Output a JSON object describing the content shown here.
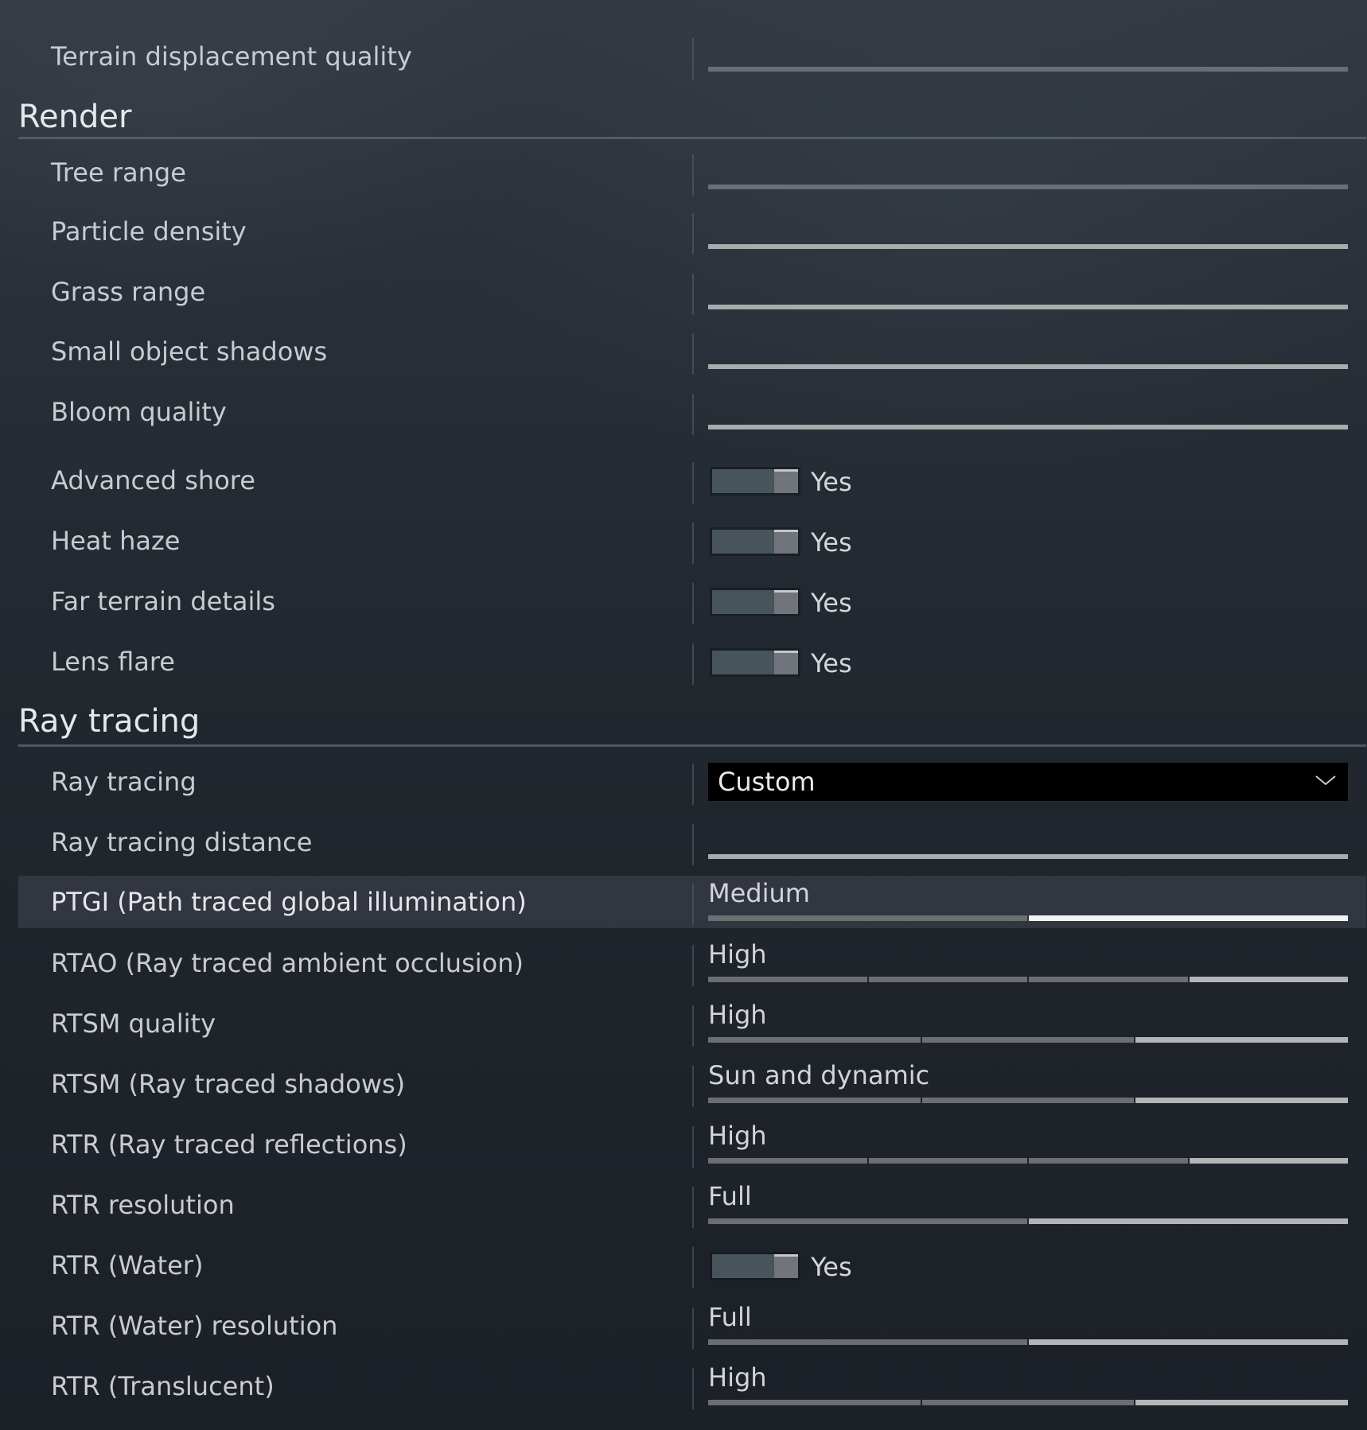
{
  "top_row": {
    "label": "Terrain displacement quality"
  },
  "render": {
    "title": "Render",
    "sliders": [
      {
        "label": "Tree range",
        "tone": "dark"
      },
      {
        "label": "Particle density",
        "tone": "light"
      },
      {
        "label": "Grass range",
        "tone": "light"
      },
      {
        "label": "Small object shadows",
        "tone": "light"
      },
      {
        "label": "Bloom quality",
        "tone": "light"
      }
    ],
    "toggles": [
      {
        "label": "Advanced shore",
        "value": "Yes"
      },
      {
        "label": "Heat haze",
        "value": "Yes"
      },
      {
        "label": "Far terrain details",
        "value": "Yes"
      },
      {
        "label": "Lens flare",
        "value": "Yes"
      }
    ]
  },
  "ray_tracing": {
    "title": "Ray tracing",
    "mode": {
      "label": "Ray tracing",
      "value": "Custom",
      "icon": "chevron-down-icon"
    },
    "distance": {
      "label": "Ray tracing distance"
    },
    "ptgi": {
      "label": "PTGI (Path traced global illumination)",
      "value": "Medium",
      "level": 1,
      "steps": 2
    },
    "rtao": {
      "label": "RTAO (Ray traced ambient occlusion)",
      "value": "High",
      "level": 3,
      "steps": 4
    },
    "rtsm_quality": {
      "label": "RTSM quality",
      "value": "High",
      "level": 2,
      "steps": 3
    },
    "rtsm": {
      "label": "RTSM (Ray traced shadows)",
      "value": "Sun and dynamic",
      "level": 2,
      "steps": 3
    },
    "rtr": {
      "label": "RTR (Ray traced reflections)",
      "value": "High",
      "level": 3,
      "steps": 4
    },
    "rtr_resolution": {
      "label": "RTR resolution",
      "value": "Full",
      "level": 1,
      "steps": 2
    },
    "rtr_water": {
      "label": "RTR (Water)",
      "value": "Yes"
    },
    "rtr_water_resolution": {
      "label": "RTR (Water) resolution",
      "value": "Full",
      "level": 1,
      "steps": 2
    },
    "rtr_translucent": {
      "label": "RTR (Translucent)",
      "value": "High",
      "level": 2,
      "steps": 3
    }
  },
  "colors": {
    "highlight_row": "#3f4652",
    "dropdown_bg": "#000000",
    "active_segment": "#b3b5b7",
    "inactive_segment": "#6c6f72"
  }
}
